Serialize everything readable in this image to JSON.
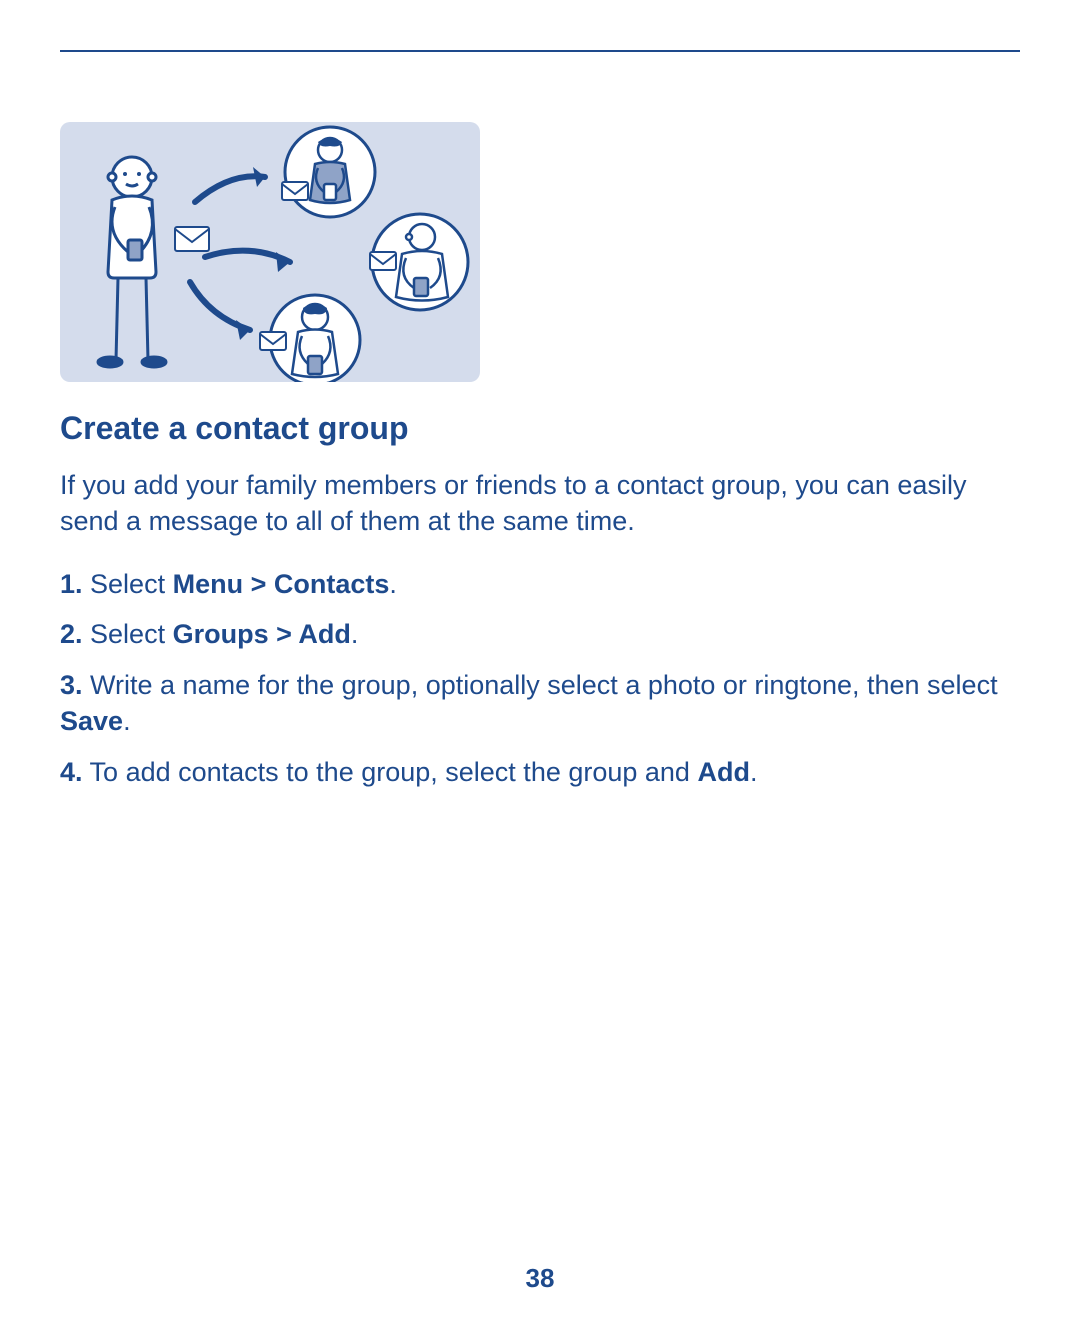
{
  "heading": "Create a contact group",
  "intro": "If you add your family members or friends to a contact group, you can easily send a message to all of them at the same time.",
  "steps": {
    "s1": {
      "num": "1.",
      "pre": " Select ",
      "bold": "Menu > Contacts",
      "post": "."
    },
    "s2": {
      "num": "2.",
      "pre": " Select ",
      "bold": "Groups > Add",
      "post": "."
    },
    "s3": {
      "num": "3.",
      "pre": " Write a name for the group, optionally select a photo or ringtone, then select ",
      "bold": "Save",
      "post": "."
    },
    "s4": {
      "num": "4.",
      "pre": " To add contacts to the group, select the group and ",
      "bold": "Add",
      "post": "."
    }
  },
  "page_number": "38"
}
